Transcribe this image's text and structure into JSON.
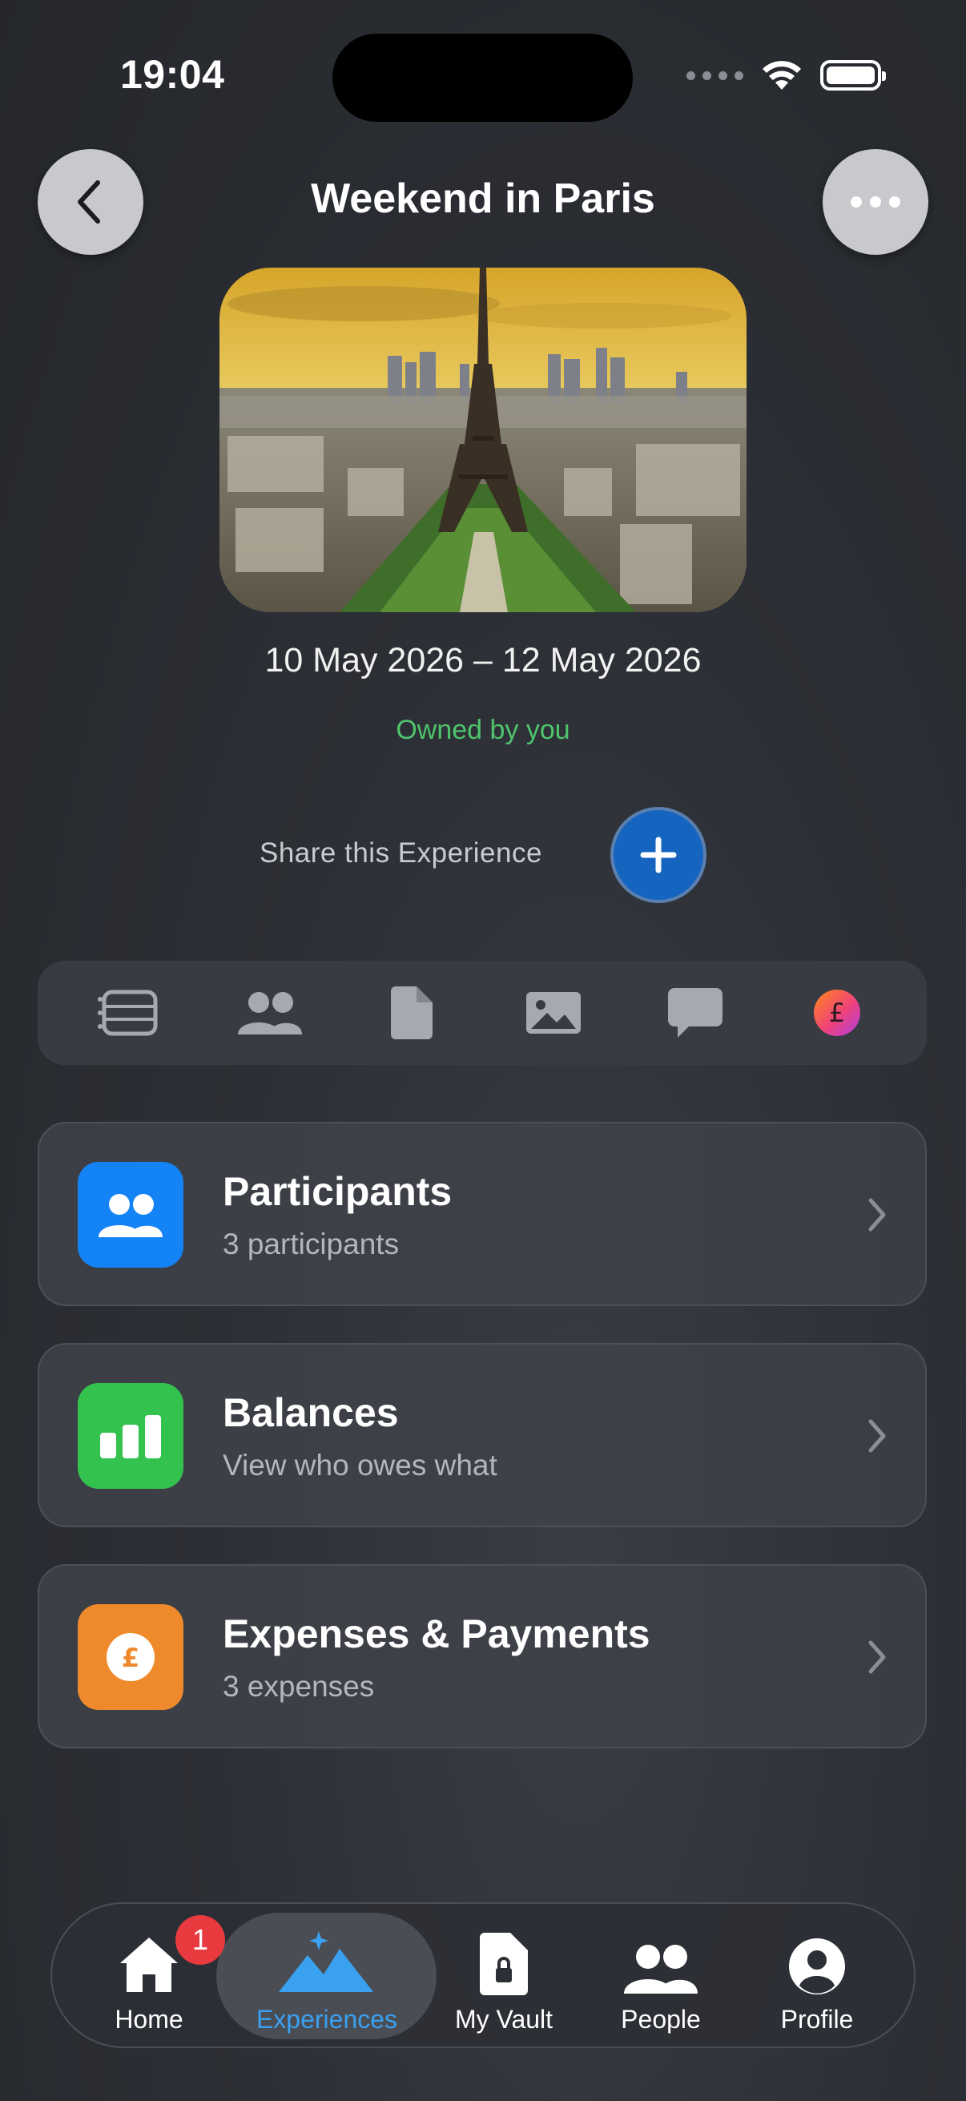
{
  "status_bar": {
    "time": "19:04"
  },
  "header": {
    "title": "Weekend in Paris"
  },
  "experience": {
    "dates": "10 May 2026 – 12 May 2026",
    "owner": "Owned by you",
    "share_label": "Share this Experience"
  },
  "tabs": [
    {
      "icon": "list-icon"
    },
    {
      "icon": "people-icon"
    },
    {
      "icon": "document-icon"
    },
    {
      "icon": "photo-icon"
    },
    {
      "icon": "chat-icon"
    },
    {
      "icon": "pound-icon"
    }
  ],
  "cards": [
    {
      "title": "Participants",
      "subtitle": "3 participants",
      "icon": "people-icon",
      "color": "#1483f5"
    },
    {
      "title": "Balances",
      "subtitle": "View who owes what",
      "icon": "bar-chart-icon",
      "color": "#34c24f"
    },
    {
      "title": "Expenses & Payments",
      "subtitle": "3 expenses",
      "icon": "pound-icon",
      "color": "#ef8a2c"
    }
  ],
  "nav": {
    "items": [
      {
        "label": "Home",
        "icon": "home-icon",
        "badge": "1"
      },
      {
        "label": "Experiences",
        "icon": "mountains-icon",
        "active": true
      },
      {
        "label": "My Vault",
        "icon": "vault-icon"
      },
      {
        "label": "People",
        "icon": "people-icon"
      },
      {
        "label": "Profile",
        "icon": "profile-icon"
      }
    ]
  },
  "colors": {
    "accent": "#3aa0f0",
    "owner_green": "#4fc46d",
    "share_button": "#1565c0",
    "badge": "#e93a3f"
  }
}
